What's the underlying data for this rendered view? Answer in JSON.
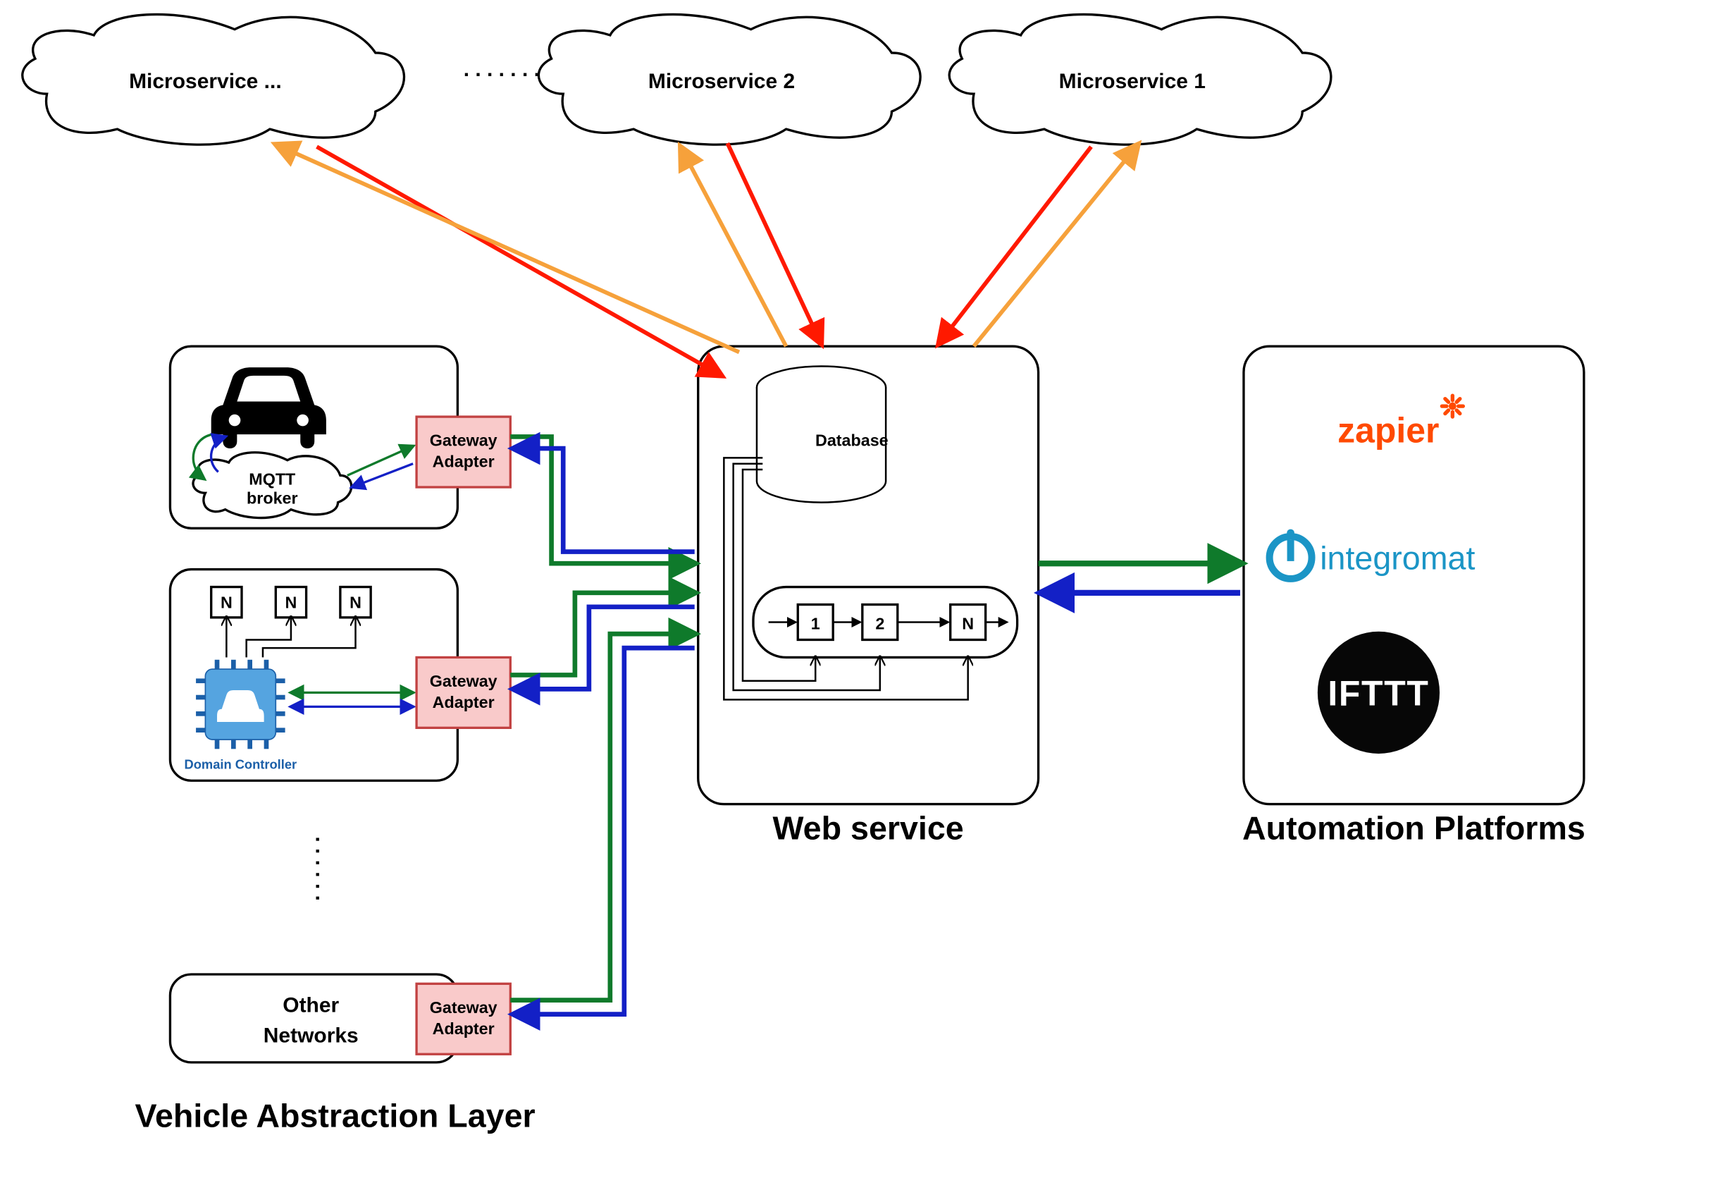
{
  "clouds": {
    "ms_n": "Microservice ...",
    "ms_2": "Microservice 2",
    "ms_1": "Microservice 1",
    "dots": ". . . . . . ."
  },
  "vehicle_layer": {
    "title": "Vehicle Abstraction Layer",
    "mqtt_line1": "MQTT",
    "mqtt_line2": "broker",
    "domainctrl": "Domain Controller",
    "nodes": {
      "n1": "N",
      "n2": "N",
      "n3": "N"
    },
    "other_line1": "Other",
    "other_line2": "Networks",
    "gateway_line1": "Gateway",
    "gateway_line2": "Adapter",
    "vdots": ". . . . . ."
  },
  "webservice": {
    "title": "Web service",
    "database": "Database",
    "pipeline": {
      "s1": "1",
      "s2": "2",
      "sn": "N"
    }
  },
  "automation": {
    "title": "Automation Platforms",
    "zapier": "zapier",
    "integromat": "integromat",
    "ifttt": "IFTTT"
  },
  "colors": {
    "red": "#ff1900",
    "orange": "#f6a13b",
    "green": "#0f7a2b",
    "blue": "#1320c6"
  }
}
